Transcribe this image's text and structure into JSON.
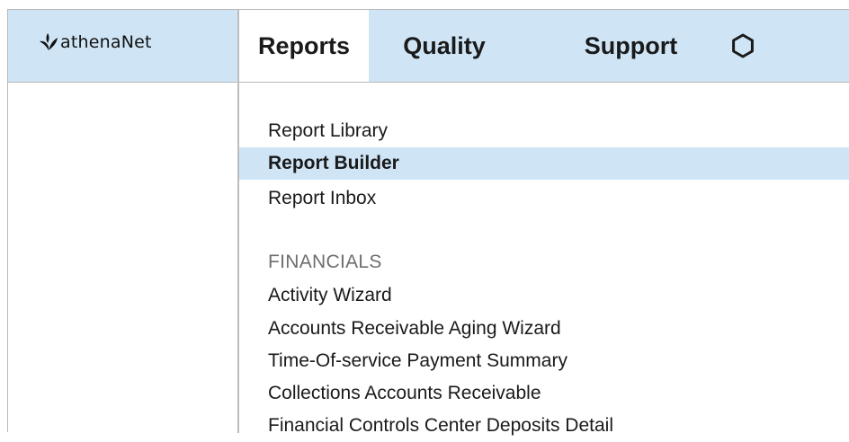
{
  "app": {
    "logo_text": "athenaNet",
    "logo_icon": "athena-leaf-icon"
  },
  "nav": {
    "tabs": [
      {
        "label": "Reports",
        "active": true
      },
      {
        "label": "Quality",
        "active": false
      },
      {
        "label": "Support",
        "active": false
      }
    ],
    "settings_icon": "gear-icon"
  },
  "reports_menu": {
    "items": [
      {
        "label": "Report Library",
        "selected": false
      },
      {
        "label": "Report Builder",
        "selected": true
      },
      {
        "label": "Report Inbox",
        "selected": false
      }
    ],
    "financials": {
      "header": "FINANCIALS",
      "items": [
        {
          "label": "Activity Wizard"
        },
        {
          "label": "Accounts Receivable Aging Wizard"
        },
        {
          "label": "Time-Of-service Payment Summary"
        },
        {
          "label": "Collections Accounts Receivable"
        },
        {
          "label": "Financial Controls Center Deposits Detail"
        }
      ]
    }
  },
  "colors": {
    "accent_bg": "#cfe5f6",
    "text": "#1a1a1a",
    "section_header": "#6e6e6e",
    "divider": "#b8b8b8"
  }
}
